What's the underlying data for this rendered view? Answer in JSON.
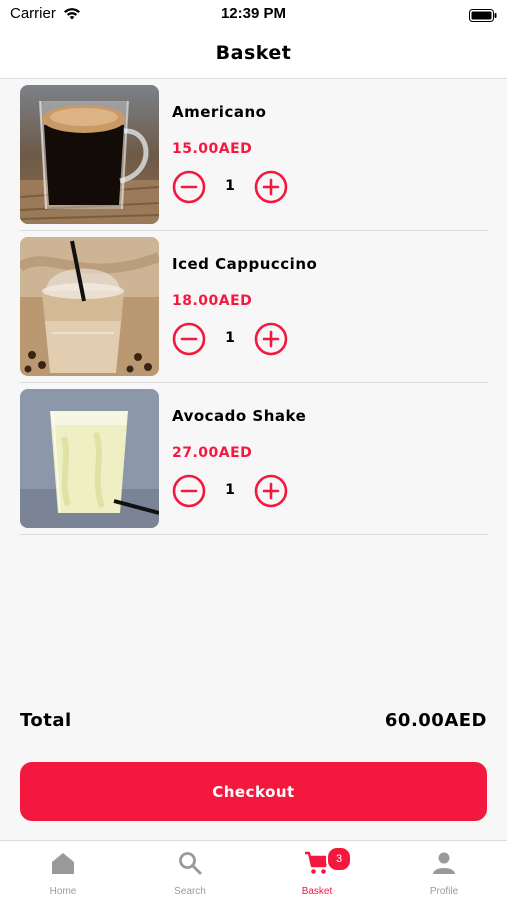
{
  "status_bar": {
    "carrier": "Carrier",
    "time": "12:39 PM"
  },
  "nav": {
    "title": "Basket"
  },
  "items": [
    {
      "name": "Americano",
      "price": "15.00AED",
      "quantity": "1",
      "image_icon": "americano-photo"
    },
    {
      "name": "Iced Cappuccino",
      "price": "18.00AED",
      "quantity": "1",
      "image_icon": "iced-cappuccino-photo"
    },
    {
      "name": "Avocado Shake",
      "price": "27.00AED",
      "quantity": "1",
      "image_icon": "avocado-shake-photo"
    }
  ],
  "summary": {
    "total_label": "Total",
    "total_value": "60.00AED"
  },
  "checkout": {
    "label": "Checkout"
  },
  "tabs": [
    {
      "label": "Home",
      "icon": "home-icon",
      "active": false
    },
    {
      "label": "Search",
      "icon": "search-icon",
      "active": false
    },
    {
      "label": "Basket",
      "icon": "cart-icon",
      "active": true,
      "badge": "3"
    },
    {
      "label": "Profile",
      "icon": "profile-icon",
      "active": false
    }
  ],
  "colors": {
    "accent": "#f4183f",
    "inactive_tab": "#9a9a9a",
    "background": "#f7f7f7"
  }
}
